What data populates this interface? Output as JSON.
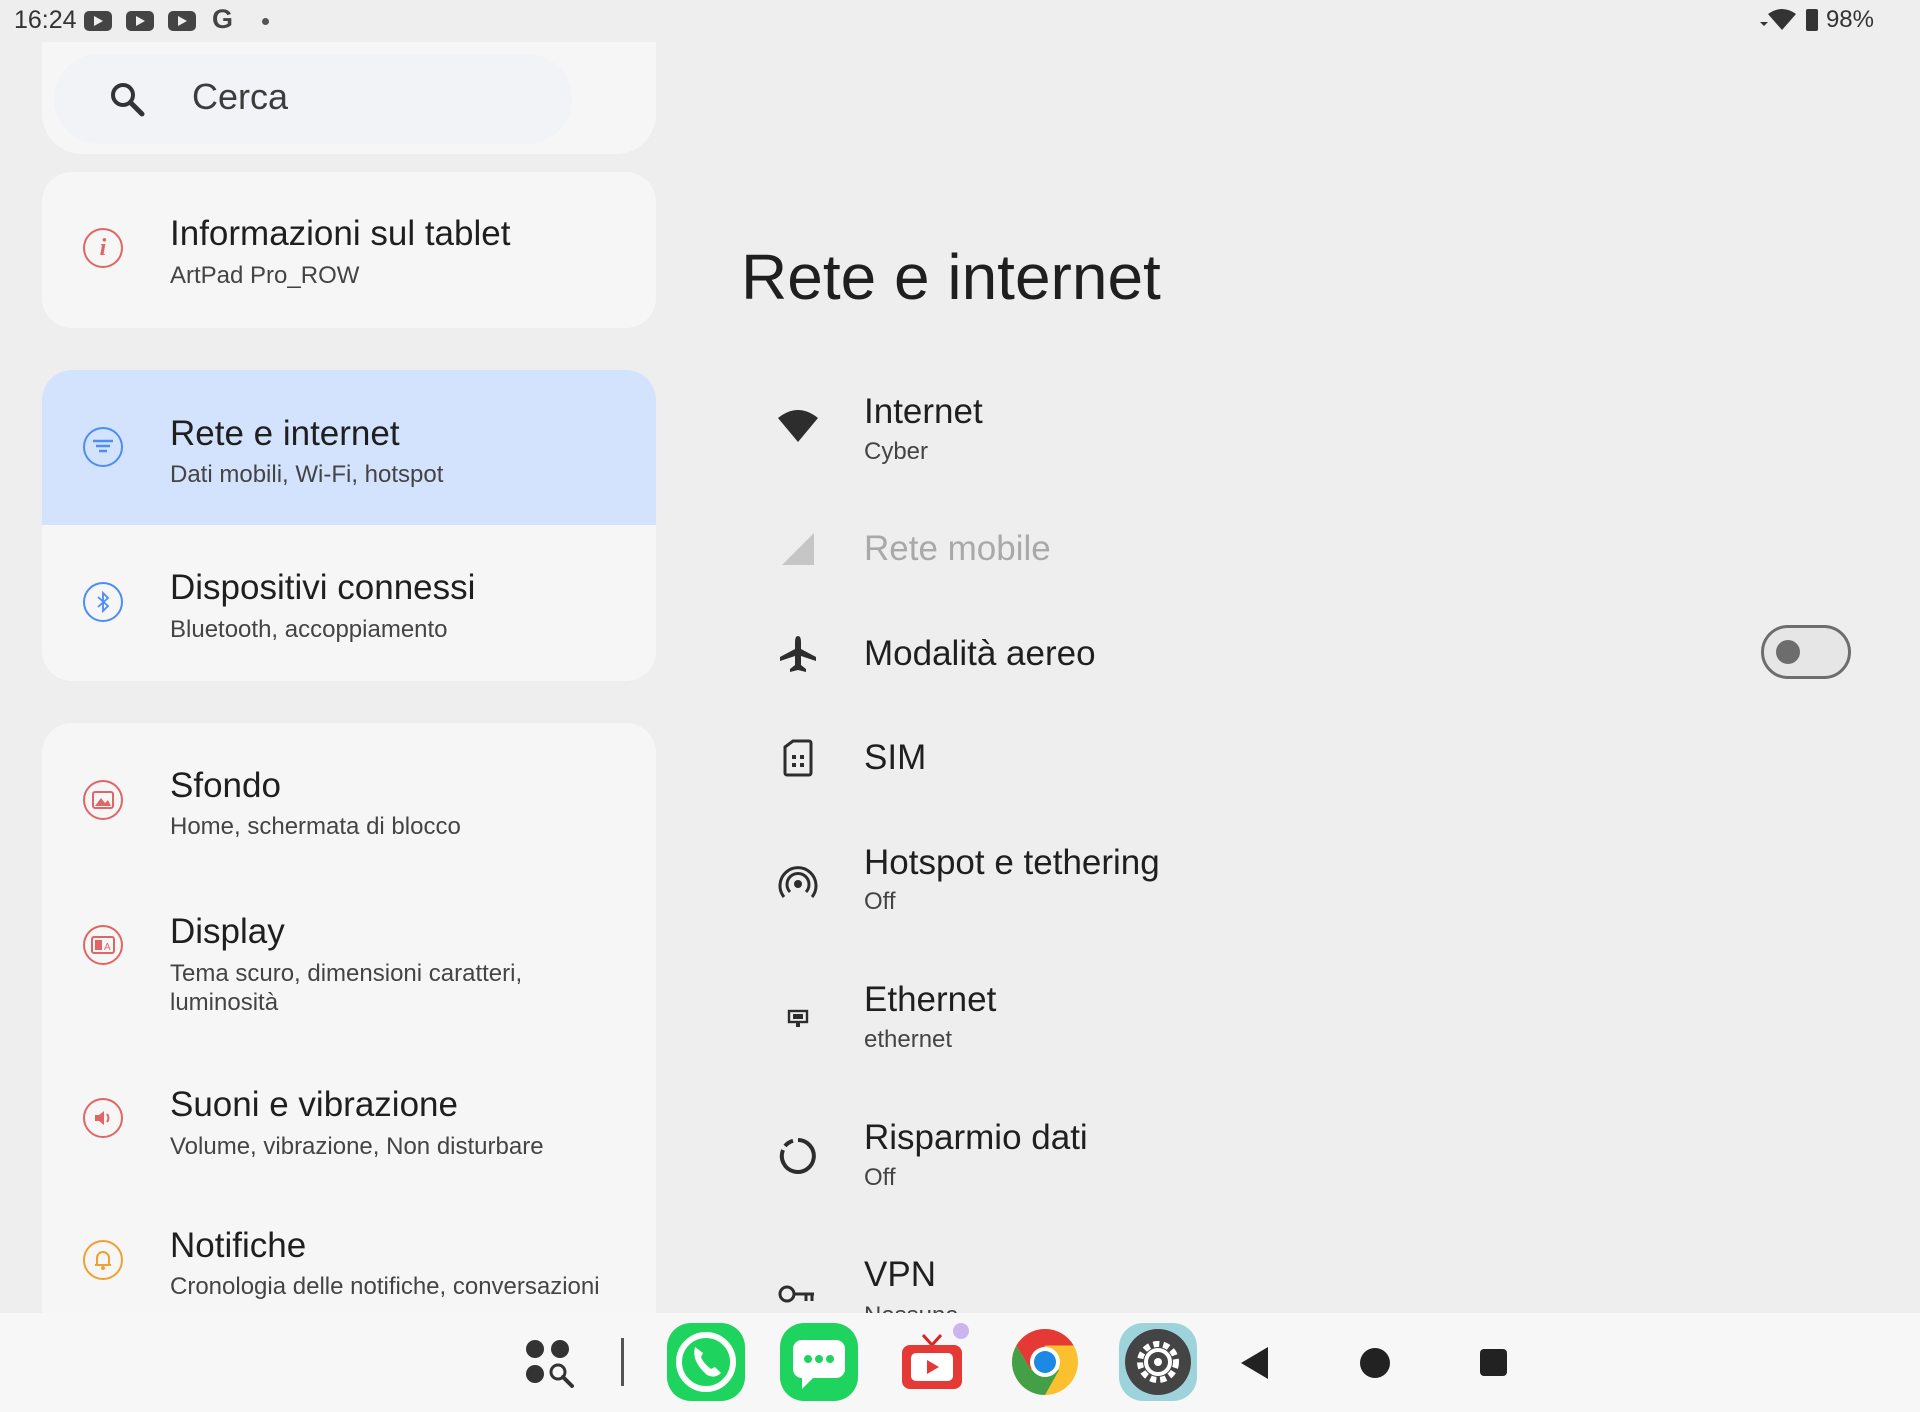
{
  "status_bar": {
    "time": "16:24",
    "battery": "98%",
    "notification_icons": [
      "youtube-icon",
      "youtube-icon",
      "youtube-icon",
      "google-icon",
      "more-dot-icon"
    ]
  },
  "sidebar": {
    "search_placeholder": "Cerca",
    "items": [
      {
        "title": "Informazioni sul tablet",
        "subtitle": "ArtPad Pro_ROW",
        "icon": "info-icon",
        "color": "#e06666"
      },
      {
        "title": "Rete e internet",
        "subtitle": "Dati mobili, Wi-Fi, hotspot",
        "icon": "network-icon",
        "color": "#4c8df6",
        "selected": true
      },
      {
        "title": "Dispositivi connessi",
        "subtitle": "Bluetooth, accoppiamento",
        "icon": "bluetooth-icon",
        "color": "#4c8df6"
      },
      {
        "title": "Sfondo",
        "subtitle": "Home, schermata di blocco",
        "icon": "wallpaper-icon",
        "color": "#e06666"
      },
      {
        "title": "Display",
        "subtitle": "Tema scuro, dimensioni caratteri, luminosità",
        "icon": "display-icon",
        "color": "#e06666"
      },
      {
        "title": "Suoni e vibrazione",
        "subtitle": "Volume, vibrazione, Non disturbare",
        "icon": "sound-icon",
        "color": "#e06666"
      },
      {
        "title": "Notifiche",
        "subtitle": "Cronologia delle notifiche, conversazioni",
        "icon": "bell-icon",
        "color": "#f0a030"
      }
    ]
  },
  "main": {
    "title": "Rete e internet",
    "rows": [
      {
        "title": "Internet",
        "subtitle": "Cyber",
        "icon": "wifi-icon"
      },
      {
        "title": "Rete mobile",
        "subtitle": "",
        "icon": "mobile-signal-icon",
        "disabled": true
      },
      {
        "title": "Modalità aereo",
        "subtitle": "",
        "icon": "airplane-icon",
        "toggle": false
      },
      {
        "title": "SIM",
        "subtitle": "",
        "icon": "sim-icon"
      },
      {
        "title": "Hotspot e tethering",
        "subtitle": "Off",
        "icon": "hotspot-icon"
      },
      {
        "title": "Ethernet",
        "subtitle": "ethernet",
        "icon": "ethernet-icon"
      },
      {
        "title": "Risparmio dati",
        "subtitle": "Off",
        "icon": "data-saver-icon"
      },
      {
        "title": "VPN",
        "subtitle": "Nessuna",
        "icon": "vpn-key-icon"
      }
    ]
  },
  "dock": {
    "apps": [
      "app-drawer-icon",
      "phone-app-icon",
      "messages-app-icon",
      "tv-app-icon",
      "chrome-app-icon",
      "settings-app-icon"
    ],
    "nav": [
      "back-icon",
      "home-icon",
      "recents-icon"
    ]
  }
}
